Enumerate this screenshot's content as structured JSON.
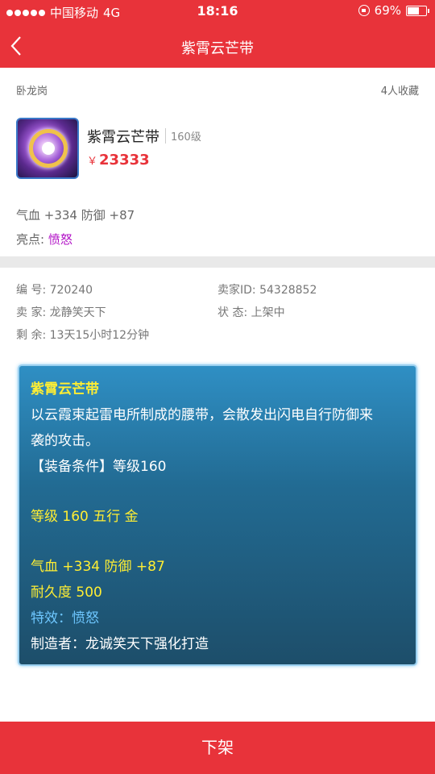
{
  "status_bar": {
    "carrier": "中国移动",
    "network": "4G",
    "time": "18:16",
    "battery": "69%",
    "battery_level": 0.69
  },
  "nav": {
    "title": "紫霄云芒带"
  },
  "item": {
    "location": "卧龙岗",
    "favorites": "4人收藏",
    "name": "紫霄云芒带",
    "level": "160级",
    "price_symbol": "￥",
    "price": "23333",
    "stats": "气血 +334 防御 +87",
    "highlight_label": "亮点:",
    "highlight_value": "愤怒"
  },
  "info": {
    "id_label": "编  号:",
    "id_value": "720240",
    "seller_id_label": "卖家ID:",
    "seller_id_value": "54328852",
    "seller_label": "卖  家:",
    "seller_value": "龙静笑天下",
    "status_label": "状  态:",
    "status_value": "上架中",
    "remaining_label": "剩  余:",
    "remaining_value": "13天15小时12分钟"
  },
  "description": {
    "title": "紫霄云芒带",
    "text_line1": "以云霞束起雷电所制成的腰带，会散发出闪电自行防御来",
    "text_line2": "袭的攻击。",
    "requirement": "【装备条件】等级160",
    "level_element": "等级 160 五行 金",
    "stats": "气血 +334 防御 +87",
    "durability": "耐久度 500",
    "special": "特效：愤怒",
    "maker": "制造者：龙诚笑天下强化打造"
  },
  "action": {
    "delist_label": "下架"
  },
  "colors": {
    "brand_red": "#e8333a",
    "purple_highlight": "#b10fc6",
    "tooltip_yellow": "#ffee33",
    "tooltip_blue": "#6ec7ff"
  }
}
